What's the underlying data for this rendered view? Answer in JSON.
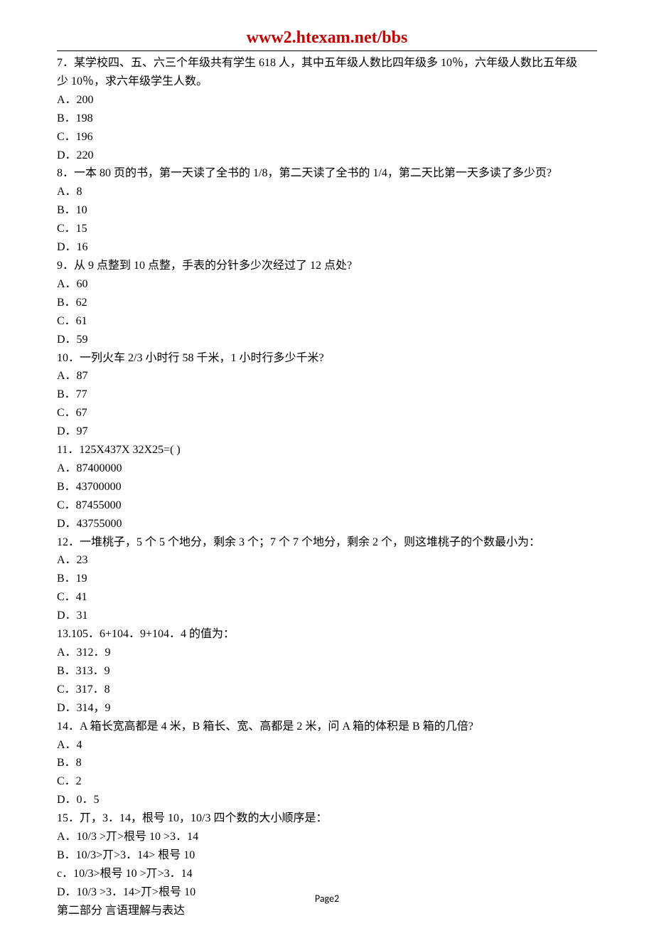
{
  "header": {
    "url": "www2.htexam.net/bbs"
  },
  "questions": [
    {
      "stem": [
        "7．某学校四、五、六三个年级共有学生 618 人，其中五年级人数比四年级多 10％，六年级人数比五年级",
        "少 10％，求六年级学生人数。"
      ],
      "options": [
        "A．200",
        "B．198",
        "C．196",
        "D．220"
      ]
    },
    {
      "stem": [
        "8．一本 80 页的书，第一天读了全书的 1/8，第二天读了全书的 1/4，第二天比第一天多读了多少页?"
      ],
      "options": [
        "A．8",
        "B．10",
        "C．15",
        "D．16"
      ]
    },
    {
      "stem": [
        "9．从 9 点整到 10 点整，手表的分针多少次经过了 12 点处?"
      ],
      "options": [
        "A．60",
        "B．62",
        "C．61",
        "D．59"
      ]
    },
    {
      "stem": [
        "10．一列火车 2/3 小时行 58 千米，1 小时行多少千米?"
      ],
      "options": [
        "A．87",
        "B．77",
        "C．67",
        "D．97"
      ]
    },
    {
      "stem": [
        "11．125X437X 32X25=( )"
      ],
      "options": [
        "A．87400000",
        "B．43700000",
        "C．87455000",
        "D．43755000"
      ]
    },
    {
      "stem": [
        "12．一堆桃子，5 个 5 个地分，剩余 3 个；7 个 7 个地分，剩余 2 个，则这堆桃子的个数最小为："
      ],
      "options": [
        "A．23",
        "B．19",
        "C．41",
        "D．31"
      ]
    },
    {
      "stem": [
        "13.105．6+104．9+104．4 的值为："
      ],
      "options": [
        "A．312．9",
        "B．313．9",
        "C．317．8",
        "D．314，9"
      ]
    },
    {
      "stem": [
        "14．A 箱长宽高都是 4 米，B 箱长、宽、高都是 2 米，问 A 箱的体积是 B 箱的几倍?"
      ],
      "options": [
        "A．4",
        "B．8",
        "C．2",
        "D．0．5"
      ]
    },
    {
      "stem": [
        "15．丌，3．14，根号 10，10/3 四个数的大小顺序是："
      ],
      "options": [
        "A．10/3 >丌>根号 10 >3．14",
        "B．10/3>丌>3．14> 根号 10",
        "c．10/3>根号 10 >丌>3．14",
        "D．10/3 >3．14>丌>根号 10"
      ]
    }
  ],
  "sectionHeader": "第二部分  言语理解与表达",
  "footer": {
    "pageLabel": "Page",
    "pageNumber": "2"
  }
}
